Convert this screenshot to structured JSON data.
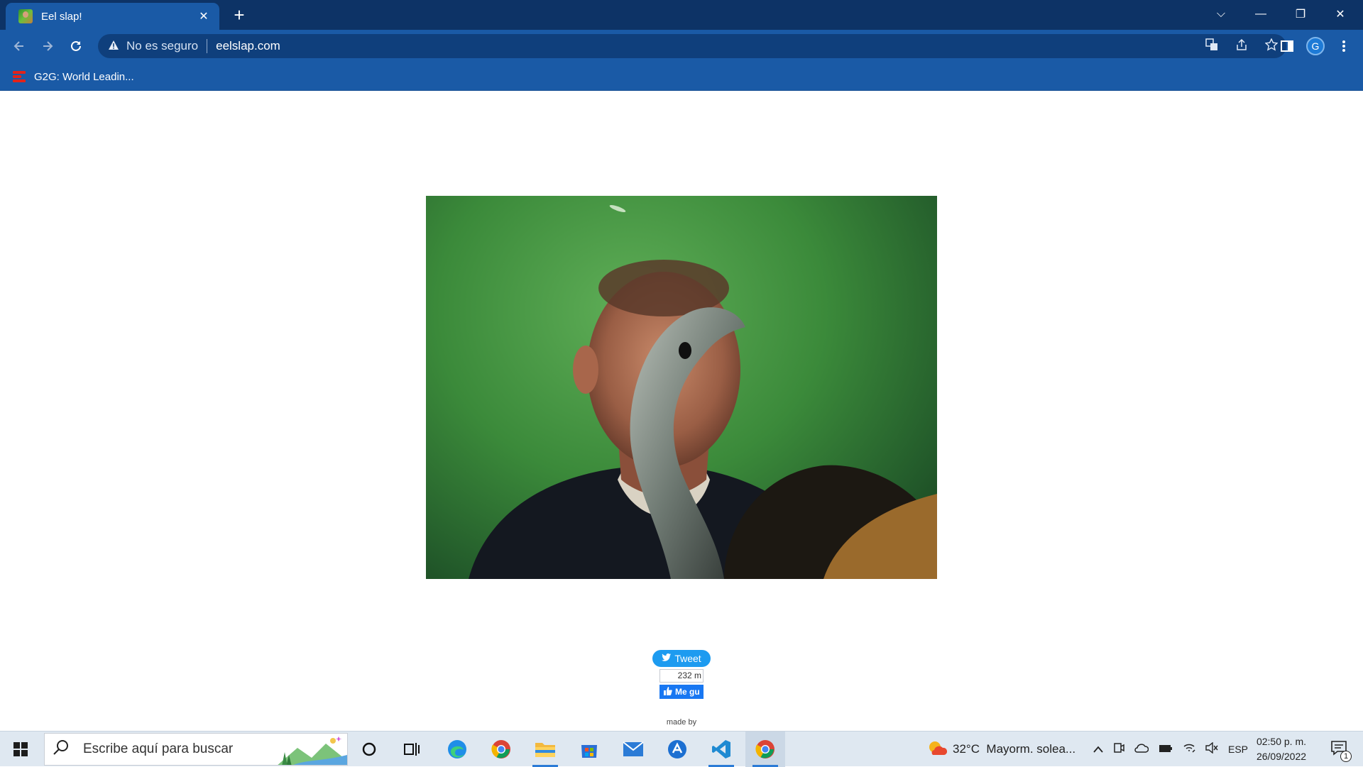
{
  "browser": {
    "tab_title": "Eel slap!",
    "tab_close": "✕",
    "new_tab": "+",
    "window_controls": {
      "dropdown": "⌵",
      "minimize": "—",
      "restore": "❐",
      "close": "✕"
    },
    "security_label": "No es seguro",
    "url": "eelslap.com",
    "profile_initial": "G",
    "bookmarks": [
      {
        "label": "G2G: World Leadin..."
      }
    ]
  },
  "page": {
    "tweet_label": "Tweet",
    "fb_count": "232 m",
    "fb_like_label": "Me gu",
    "made_by": "made by"
  },
  "taskbar": {
    "search_placeholder": "Escribe aquí para buscar",
    "weather": "32°C  Mayorm. solea...",
    "language": "ESP",
    "time": "02:50 p. m.",
    "date": "26/09/2022",
    "notification_count": "1"
  },
  "colors": {
    "tab_strip": "#0d3366",
    "toolbar": "#1a5aa6",
    "tweet": "#1d9bf0",
    "facebook": "#1877f2",
    "taskbar": "#dfe8f1"
  }
}
